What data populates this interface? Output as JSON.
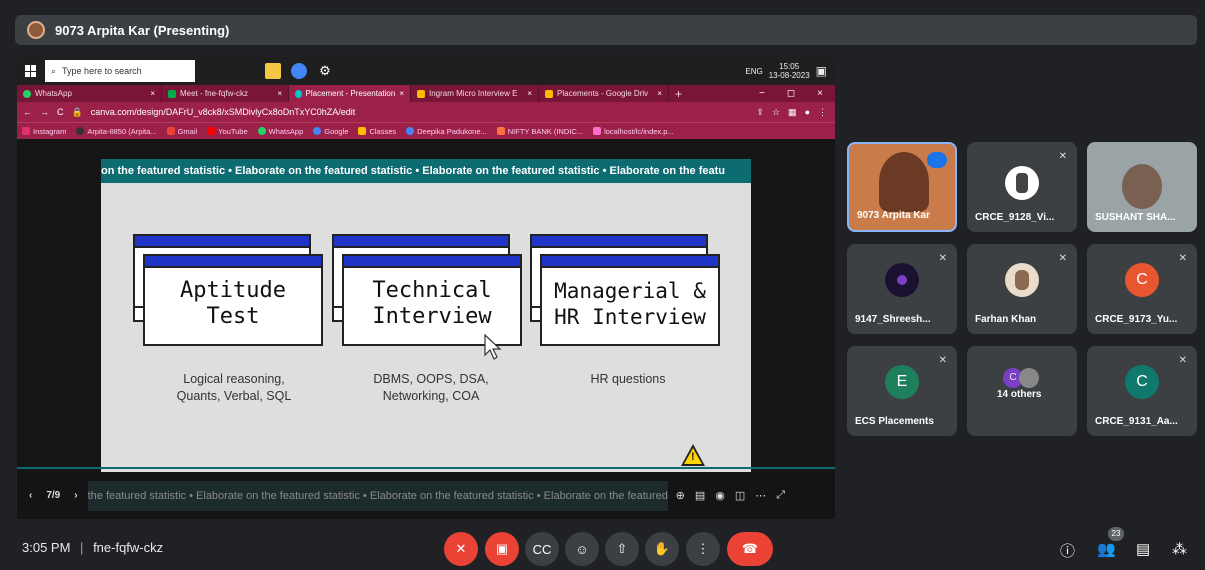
{
  "presenter": {
    "label": "9073 Arpita Kar (Presenting)"
  },
  "taskbar": {
    "search_placeholder": "Type here to search",
    "lang": "ENG",
    "time": "15:05",
    "date": "13-08-2023"
  },
  "tabs": [
    {
      "label": "WhatsApp"
    },
    {
      "label": "Meet - fne-fqfw-ckz"
    },
    {
      "label": "Placement - Presentation"
    },
    {
      "label": "Ingram Micro Interview E"
    },
    {
      "label": "Placements - Google Driv"
    }
  ],
  "address": {
    "url": "canva.com/design/DAFrU_v8ck8/xSMDivlyCx8oDnTxYC0hZA/edit"
  },
  "bookmarks": [
    {
      "label": "Instagram"
    },
    {
      "label": "Arpita-8850 (Arpita..."
    },
    {
      "label": "Gmail"
    },
    {
      "label": "YouTube"
    },
    {
      "label": "WhatsApp"
    },
    {
      "label": "Google"
    },
    {
      "label": "Classes"
    },
    {
      "label": "Deepika Padukone..."
    },
    {
      "label": "NIFTY BANK (INDIC..."
    },
    {
      "label": "localhost/lc/index.p..."
    }
  ],
  "slide": {
    "marquee": "on the featured statistic • Elaborate on the featured statistic • Elaborate on the featured statistic • Elaborate on the featu",
    "cards": [
      {
        "title_line1": "Aptitude",
        "title_line2": "Test",
        "desc_line1": "Logical reasoning,",
        "desc_line2": "Quants, Verbal, SQL"
      },
      {
        "title_line1": "Technical",
        "title_line2": "Interview",
        "desc_line1": "DBMS, OOPS, DSA,",
        "desc_line2": "Networking, COA"
      },
      {
        "title_line1": "Managerial &",
        "title_line2": "HR Interview",
        "desc_line1": "HR questions",
        "desc_line2": ""
      }
    ]
  },
  "slide_controls": {
    "page": "7/9",
    "marquee": "the featured statistic • Elaborate on the featured statistic • Elaborate on the featured statistic • Elaborate on the featured statistic"
  },
  "participants": [
    {
      "name": "9073 Arpita Kar",
      "initial": "",
      "color": "#b86b3a"
    },
    {
      "name": "CRCE_9128_Vi...",
      "initial": "",
      "color": "#5b5b5b"
    },
    {
      "name": "SUSHANT SHA...",
      "initial": "",
      "color": "#7f8a8c"
    },
    {
      "name": "9147_Shreesh...",
      "initial": "",
      "color": "#1a1030"
    },
    {
      "name": "Farhan Khan",
      "initial": "",
      "color": "#c9a27a"
    },
    {
      "name": "CRCE_9173_Yu...",
      "initial": "C",
      "color": "#e8552f"
    },
    {
      "name": "ECS Placements",
      "initial": "E",
      "color": "#1e7f5c"
    },
    {
      "name": "14 others",
      "initial": "C",
      "color": "#7b3fc4"
    },
    {
      "name": "CRCE_9131_Aa...",
      "initial": "C",
      "color": "#10796d"
    }
  ],
  "meeting": {
    "time": "3:05 PM",
    "code": "fne-fqfw-ckz",
    "participant_count": "23"
  }
}
